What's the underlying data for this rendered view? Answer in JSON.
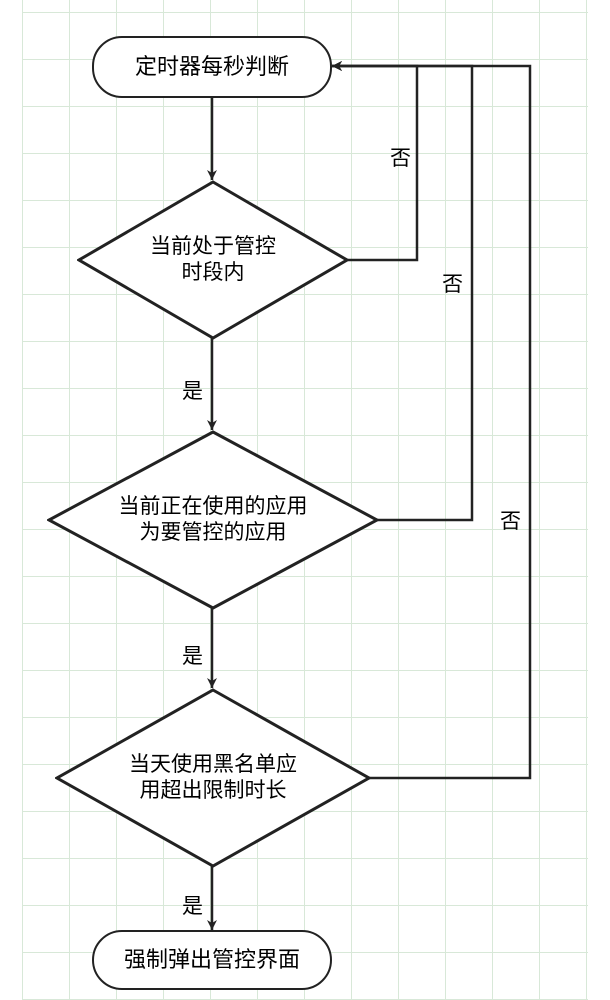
{
  "chart_data": {
    "type": "flowchart",
    "nodes": [
      {
        "id": "start",
        "shape": "terminator",
        "text": "定时器每秒判断"
      },
      {
        "id": "d1",
        "shape": "decision",
        "text": "当前处于管控\n时段内"
      },
      {
        "id": "d2",
        "shape": "decision",
        "text": "当前正在使用的应用\n为要管控的应用"
      },
      {
        "id": "d3",
        "shape": "decision",
        "text": "当天使用黑名单应\n用超出限制时长"
      },
      {
        "id": "end",
        "shape": "terminator",
        "text": "强制弹出管控界面"
      }
    ],
    "edges": [
      {
        "from": "start",
        "to": "d1",
        "label": ""
      },
      {
        "from": "d1",
        "to": "d2",
        "label": "是"
      },
      {
        "from": "d2",
        "to": "d3",
        "label": "是"
      },
      {
        "from": "d3",
        "to": "end",
        "label": "是"
      },
      {
        "from": "d1",
        "to": "start",
        "label": "否"
      },
      {
        "from": "d2",
        "to": "start",
        "label": "否"
      },
      {
        "from": "d3",
        "to": "start",
        "label": "否"
      }
    ]
  },
  "nodes": {
    "start": "定时器每秒判断",
    "d1_l1": "当前处于管控",
    "d1_l2": "时段内",
    "d2_l1": "当前正在使用的应用",
    "d2_l2": "为要管控的应用",
    "d3_l1": "当天使用黑名单应",
    "d3_l2": "用超出限制时长",
    "end": "强制弹出管控界面"
  },
  "labels": {
    "yes": "是",
    "no": "否"
  }
}
